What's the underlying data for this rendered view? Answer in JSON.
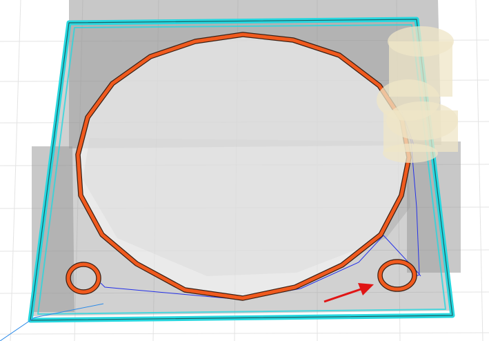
{
  "viewport": {
    "title": "",
    "background": "#ffffff",
    "grid_color": "#e3e3e3",
    "model_color": "#9a9a9a",
    "perimeter_color": "#27d7df",
    "perimeter_core": "#1b5e63",
    "circle_path_color": "#f05a1e",
    "path_edge_color": "#3a2015",
    "travel_color": "#2430e8",
    "travel_start_color": "#2b8ae8",
    "ghost_color": "#efe6c7",
    "arrow_color": "#e01515"
  },
  "layers": {
    "model": "gray-model",
    "perimeter": "cyan-outer-perimeter",
    "big_circle": "orange-large-hole-path",
    "small_left": "orange-small-hole-left",
    "small_right": "orange-small-hole-right",
    "travel": "blue-travel-moves",
    "ghost": "ghost-nozzle-preview",
    "marker": "red-annotation-arrow"
  }
}
